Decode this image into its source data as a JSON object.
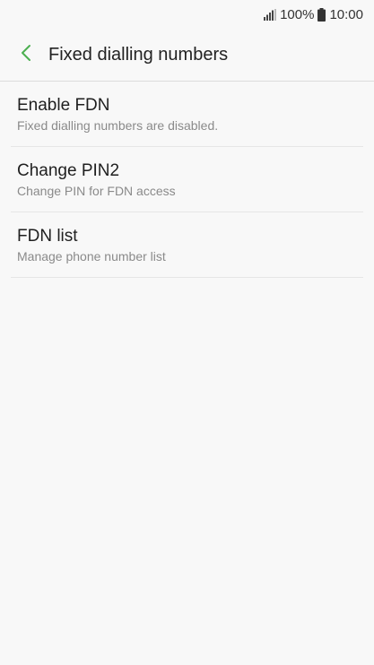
{
  "status_bar": {
    "battery_percent": "100%",
    "time": "10:00",
    "icons": [
      "signal-icon",
      "battery-icon"
    ]
  },
  "header": {
    "title": "Fixed dialling numbers",
    "back_icon": "chevron-left-icon",
    "accent_color": "#4caf50"
  },
  "settings": {
    "items": [
      {
        "title": "Enable FDN",
        "subtitle": "Fixed dialling numbers are disabled."
      },
      {
        "title": "Change PIN2",
        "subtitle": "Change PIN for FDN access"
      },
      {
        "title": "FDN list",
        "subtitle": "Manage phone number list"
      }
    ]
  }
}
